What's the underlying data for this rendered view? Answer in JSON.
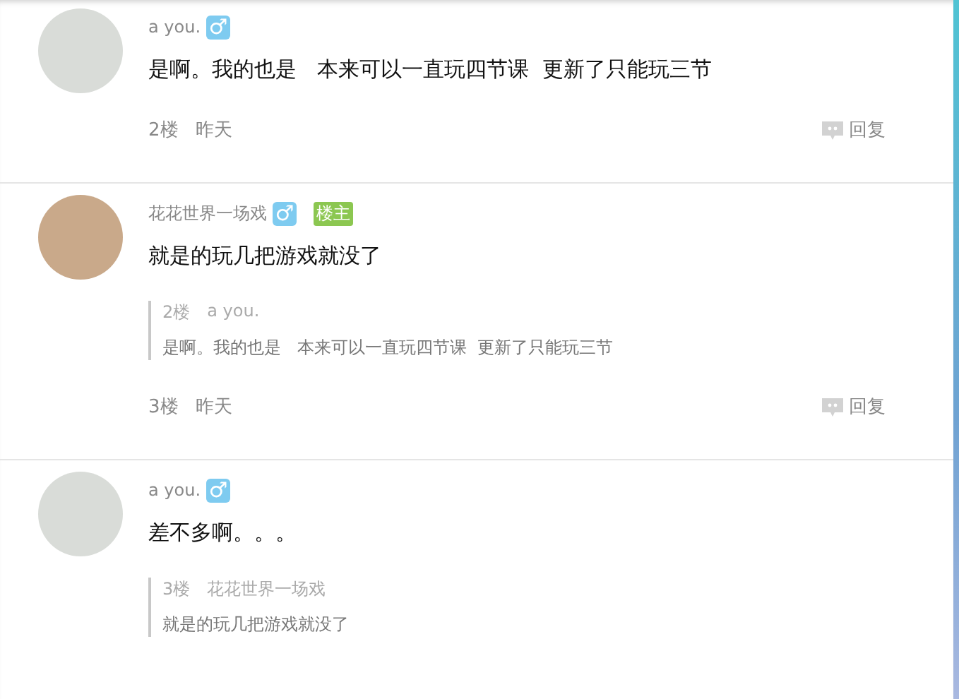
{
  "comments": [
    {
      "author": "a  you.",
      "gender_icon": "♂",
      "is_op": false,
      "content": "是啊。我的也是   本来可以一直玩四节课  更新了只能玩三节",
      "floor": "2楼",
      "time": "昨天",
      "reply": "回复"
    },
    {
      "author": "花花世界一场戏",
      "gender_icon": "♂",
      "is_op": true,
      "op_badge": "楼主",
      "content": "就是的玩几把游戏就没了",
      "quote": {
        "floor": "2楼",
        "author": "a  you.",
        "text": "是啊。我的也是   本来可以一直玩四节课  更新了只能玩三节"
      },
      "floor": "3楼",
      "time": "昨天",
      "reply": "回复"
    },
    {
      "author": "a  you.",
      "gender_icon": "♂",
      "is_op": false,
      "content": "差不多啊。。。",
      "quote": {
        "floor": "3楼",
        "author": "花花世界一场戏",
        "text": "就是的玩几把游戏就没了"
      }
    }
  ]
}
